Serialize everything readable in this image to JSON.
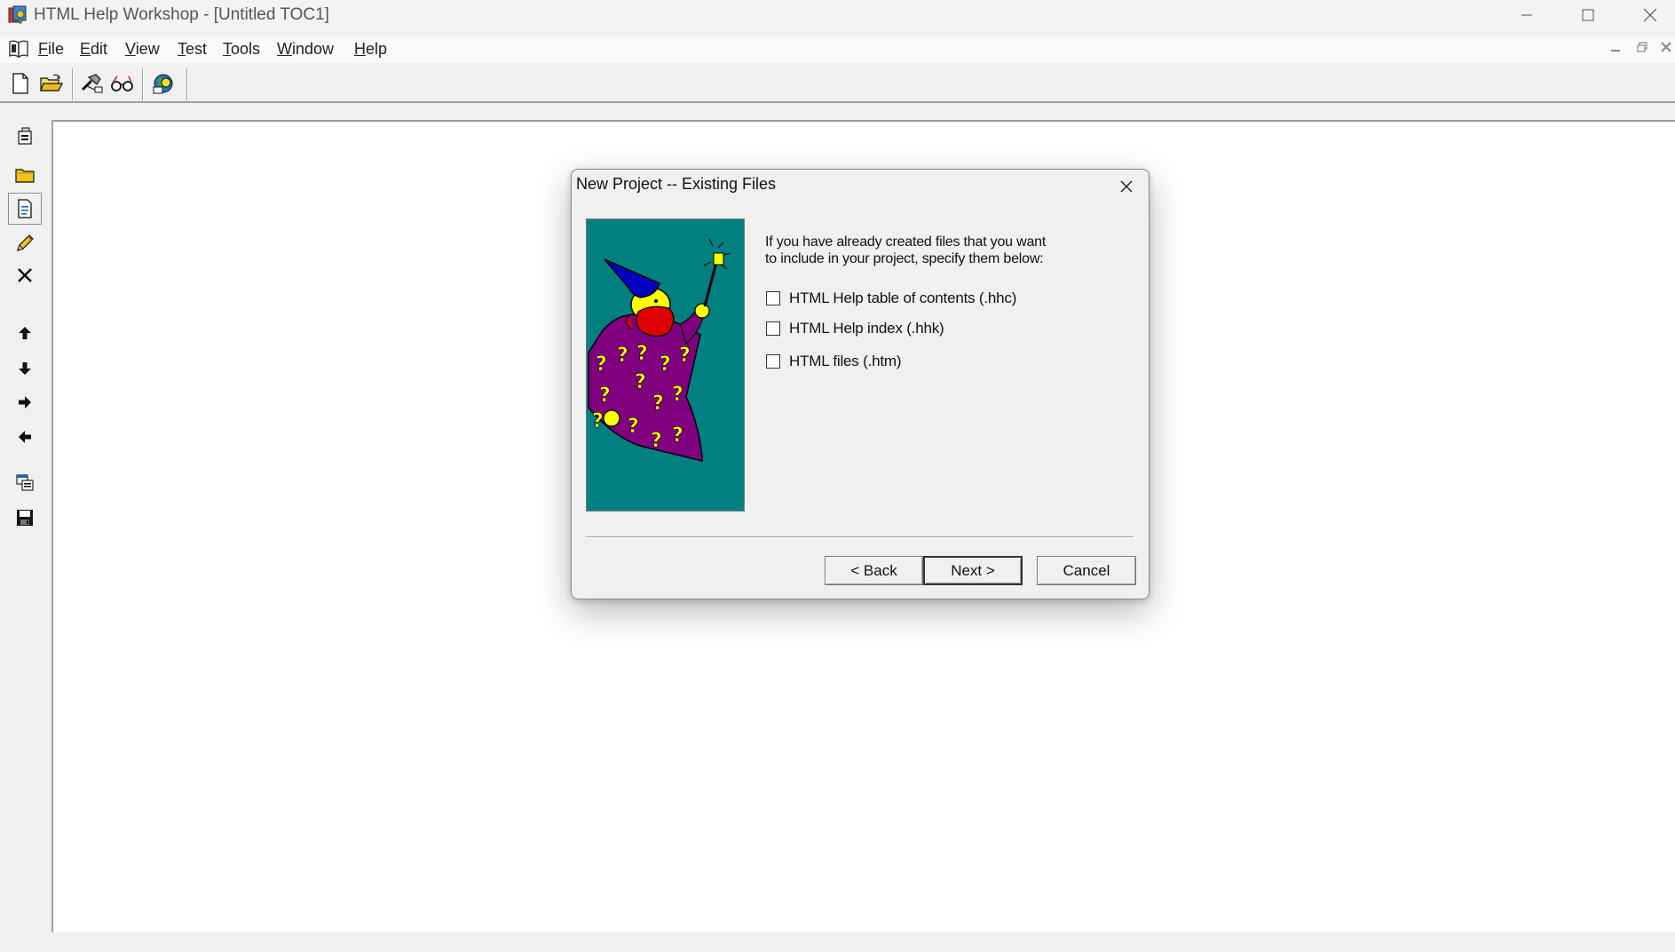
{
  "window": {
    "title": "HTML Help Workshop - [Untitled TOC1]",
    "controls": [
      "minimize",
      "maximize",
      "close"
    ]
  },
  "menu": {
    "items": [
      {
        "label": "File",
        "accel": "F"
      },
      {
        "label": "Edit",
        "accel": "E"
      },
      {
        "label": "View",
        "accel": "V"
      },
      {
        "label": "Test",
        "accel": "T"
      },
      {
        "label": "Tools",
        "accel": "T"
      },
      {
        "label": "Window",
        "accel": "W"
      },
      {
        "label": "Help",
        "accel": "H"
      }
    ]
  },
  "toolbar": {
    "buttons": [
      "new-file-icon",
      "open-folder-icon",
      "compile-icon",
      "view-compiled-icon",
      "html-help-image-editor-icon"
    ]
  },
  "sidebar": {
    "buttons": [
      "contents-properties-icon",
      "insert-heading-icon",
      "insert-page-icon",
      "edit-selection-icon",
      "delete-selection-icon",
      "move-up-icon",
      "move-down-icon",
      "move-right-icon",
      "move-left-icon",
      "view-html-source-icon",
      "save-file-icon"
    ]
  },
  "dialog": {
    "title": "New Project -- Existing Files",
    "prompt_line1": "If you have already created files that you want",
    "prompt_line2": "to include in your project, specify them below:",
    "checkboxes": [
      {
        "label": "HTML Help table of contents (.hhc)",
        "checked": false
      },
      {
        "label": "HTML Help index (.hhk)",
        "checked": false
      },
      {
        "label": "HTML files (.htm)",
        "checked": false
      }
    ],
    "back_label": "< Back",
    "next_label": "Next >",
    "cancel_label": "Cancel"
  },
  "colors": {
    "wizard_background": "#008080",
    "wizard_robe": "#800080",
    "wizard_hat": "#0000c0",
    "wizard_beard": "#e00000",
    "question_marks": "#ffff00"
  }
}
